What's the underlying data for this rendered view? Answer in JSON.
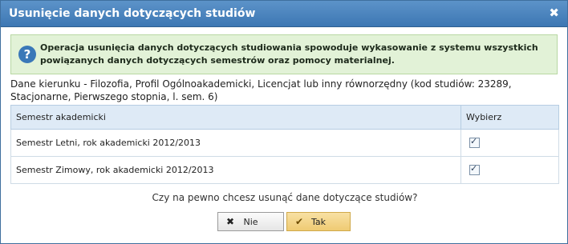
{
  "dialog": {
    "title": "Usunięcie danych dotyczących studiów",
    "close_icon": "close-icon"
  },
  "info": {
    "icon": "question-icon",
    "icon_glyph": "?",
    "text": "Operacja usunięcia danych dotyczących studiowania spowoduje wykasowanie z systemu wszystkich powiązanych danych dotyczących semestrów oraz pomocy materialnej."
  },
  "details": "Dane kierunku - Filozofia, Profil Ogólnoakademicki, Licencjat lub inny równorzędny (kod studiów: 23289, Stacjonarne, Pierwszego stopnia, l. sem. 6)",
  "table": {
    "headers": [
      "Semestr akademicki",
      "Wybierz"
    ],
    "rows": [
      {
        "semester": "Semestr Letni, rok akademicki 2012/2013",
        "checked": true
      },
      {
        "semester": "Semestr Zimowy, rok akademicki 2012/2013",
        "checked": true
      }
    ]
  },
  "question": "Czy na pewno chcesz usunąć dane dotyczące studiów?",
  "buttons": {
    "no_label": "Nie",
    "yes_label": "Tak"
  },
  "colors": {
    "titlebar": "#4a84bf",
    "info_bg": "#e2f2d7",
    "yes_button": "#efcb73"
  }
}
